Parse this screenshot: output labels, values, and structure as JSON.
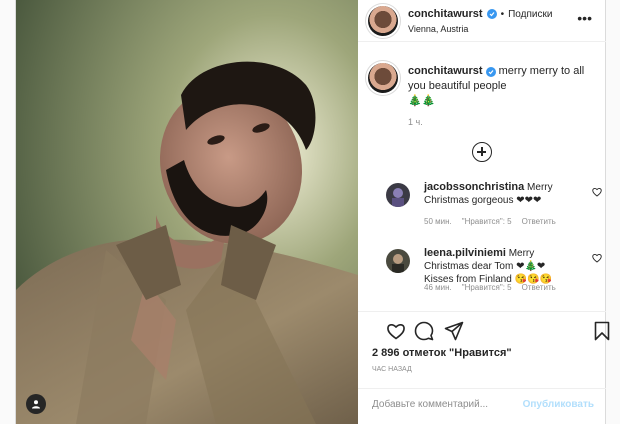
{
  "colors": {
    "accent": "#3897f0",
    "muted": "#8e8e8e",
    "text": "#262626",
    "post_button_disabled": "#b2dffc",
    "like_heart": "#262626"
  },
  "post": {
    "photo": {
      "alt_subject": "selfie-of-bearded-man-in-khaki-shirt",
      "tag_icon": "user-tag-icon"
    },
    "header": {
      "username": "conchitawurst",
      "verified_icon": "verified-badge-icon",
      "separator": "•",
      "follow_label": "Подписки",
      "location": "Vienna, Austria",
      "more_icon": "more-options-icon"
    },
    "caption": {
      "username": "conchitawurst",
      "text": "merry merry to all you beautiful people",
      "emoji": "🎄🎄",
      "time": "1 ч."
    },
    "load_more_icon": "plus-circle-icon",
    "comments": [
      {
        "username": "jacobssonchristina",
        "text": "Merry Christmas gorgeous ❤❤❤",
        "time": "50 мин.",
        "likes": "\"Нравится\": 5",
        "reply": "Ответить",
        "heart_icon": "heart-outline-icon"
      },
      {
        "username": "leena.pilviniemi",
        "text": "Merry Christmas dear Tom ❤🎄❤ Kisses from Finland 😘😘😘",
        "time": "46 мин.",
        "likes": "\"Нравится\": 5",
        "reply": "Ответить",
        "heart_icon": "heart-outline-icon"
      }
    ],
    "actions": {
      "like_icon": "heart-outline-icon",
      "comment_icon": "comment-bubble-icon",
      "share_icon": "paper-plane-icon",
      "save_icon": "bookmark-icon"
    },
    "likes_count": "2 896",
    "likes_suffix": "отметок \"Нравится\"",
    "time_ago": "час назад",
    "comment_placeholder": "Добавьте комментарий...",
    "post_button": "Опубликовать"
  }
}
